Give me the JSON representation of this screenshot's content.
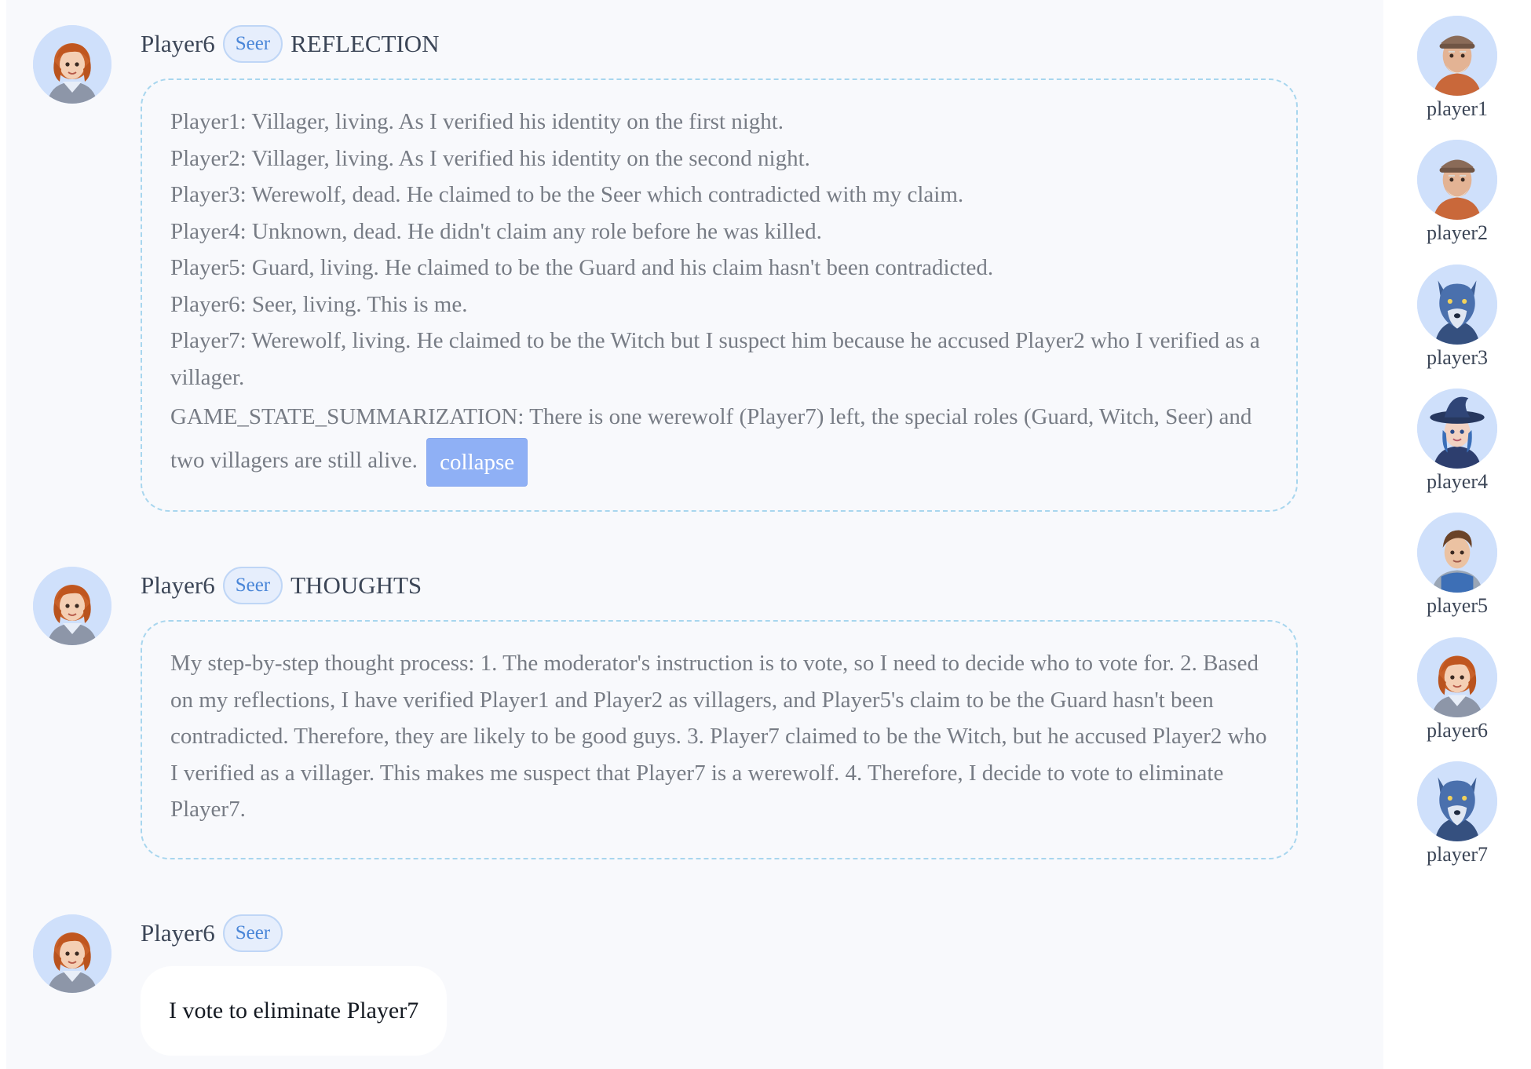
{
  "messages": [
    {
      "speaker": "Player6",
      "role": "Seer",
      "kind": "REFLECTION",
      "avatar": "girl-avatar-icon",
      "lines": [
        "Player1: Villager, living. As I verified his identity on the first night.",
        "Player2: Villager, living. As I verified his identity on the second night.",
        "Player3: Werewolf, dead. He claimed to be the Seer which contradicted with my claim.",
        "Player4: Unknown, dead. He didn't claim any role before he was killed.",
        "Player5: Guard, living. He claimed to be the Guard and his claim hasn't been contradicted.",
        "Player6: Seer, living. This is me.",
        "Player7: Werewolf, living. He claimed to be the Witch but I suspect him because he accused Player2 who I verified as a villager.",
        "GAME_STATE_SUMMARIZATION: There is one werewolf (Player7) left, the special roles (Guard, Witch, Seer) and two villagers are still alive."
      ],
      "collapse_label": "collapse"
    },
    {
      "speaker": "Player6",
      "role": "Seer",
      "kind": "THOUGHTS",
      "avatar": "girl-avatar-icon",
      "text": "My step-by-step thought process: 1. The moderator's instruction is to vote, so I need to decide who to vote for. 2. Based on my reflections, I have verified Player1 and Player2 as villagers, and Player5's claim to be the Guard hasn't been contradicted. Therefore, they are likely to be good guys. 3. Player7 claimed to be the Witch, but he accused Player2 who I verified as a villager. This makes me suspect that Player7 is a werewolf. 4. Therefore, I decide to vote to eliminate Player7."
    },
    {
      "speaker": "Player6",
      "role": "Seer",
      "avatar": "girl-avatar-icon",
      "speech": "I vote to eliminate Player7"
    }
  ],
  "roster": [
    {
      "name": "player1",
      "avatar": "old-man-avatar-icon"
    },
    {
      "name": "player2",
      "avatar": "old-man-avatar-icon"
    },
    {
      "name": "player3",
      "avatar": "wolf-avatar-icon"
    },
    {
      "name": "player4",
      "avatar": "witch-avatar-icon"
    },
    {
      "name": "player5",
      "avatar": "knight-avatar-icon"
    },
    {
      "name": "player6",
      "avatar": "girl-avatar-icon"
    },
    {
      "name": "player7",
      "avatar": "wolf-avatar-icon"
    }
  ],
  "colors": {
    "accent": "#8fb0f5",
    "badge_text": "#4a86d8",
    "dashed_border": "#a8d6ee",
    "panel_bg": "#f8f9fc"
  }
}
